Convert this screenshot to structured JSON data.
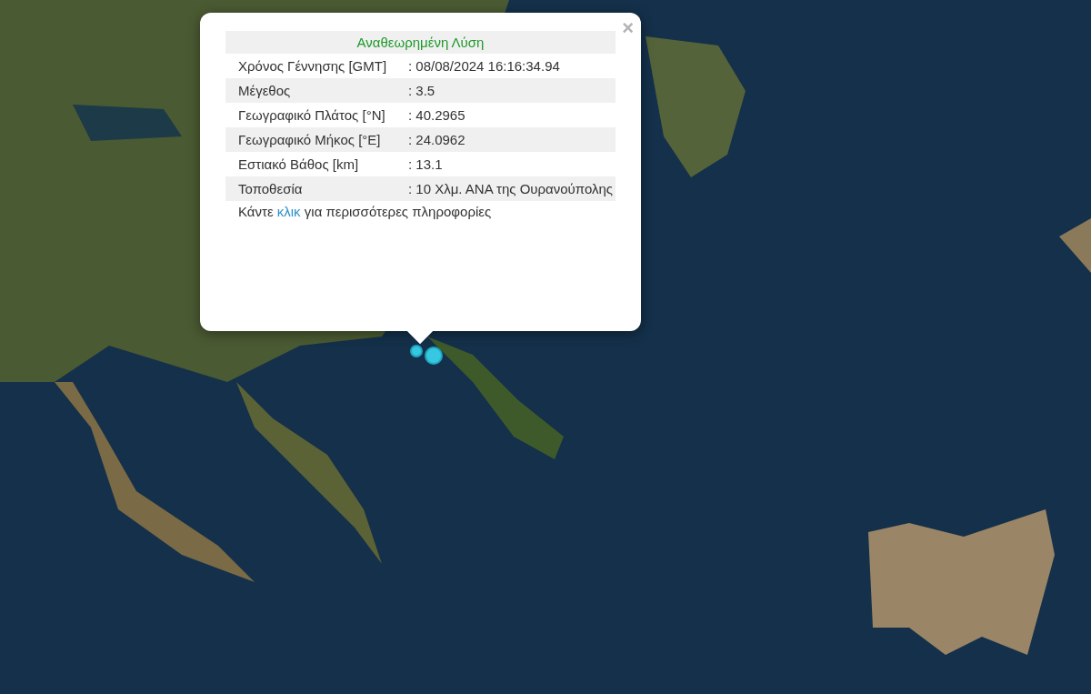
{
  "popup": {
    "close_label": "×",
    "title": "Αναθεωρημένη Λύση",
    "rows": [
      {
        "label": "Χρόνος Γέννησης [GMT]",
        "value": ": 08/08/2024 16:16:34.94"
      },
      {
        "label": "Μέγεθος",
        "value": ": 3.5"
      },
      {
        "label": "Γεωγραφικό Πλάτος [°N]",
        "value": ": 40.2965"
      },
      {
        "label": "Γεωγραφικό Μήκος [°E]",
        "value": ": 24.0962"
      },
      {
        "label": "Εστιακό Βάθος [km]",
        "value": ": 13.1"
      },
      {
        "label": "Τοποθεσία",
        "value": ": 10 Χλμ. ΑΝΑ της Ουρανούπολης"
      }
    ],
    "footer": {
      "before": "Κάντε ",
      "link": "κλικ",
      "after": " για περισσότερες πληροφορίες"
    }
  }
}
